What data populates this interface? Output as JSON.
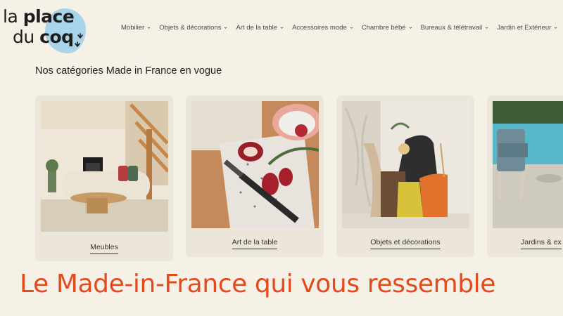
{
  "logo": {
    "line1_light": "la",
    "line1_bold": "place",
    "line2_light": "du",
    "line2_bold": "coq"
  },
  "nav": [
    {
      "label": "Mobilier"
    },
    {
      "label": "Objets & décorations"
    },
    {
      "label": "Art de la table"
    },
    {
      "label": "Accessoires mode"
    },
    {
      "label": "Chambre bébé"
    },
    {
      "label": "Bureaux & télétravail"
    },
    {
      "label": "Jardin et Extérieur"
    }
  ],
  "section_title": "Nos catégories Made in France en vogue",
  "categories": [
    {
      "label": "Meubles"
    },
    {
      "label": "Art de la table"
    },
    {
      "label": "Objets et décorations"
    },
    {
      "label": "Jardins & ex"
    }
  ],
  "headline": "Le Made-in-France qui vous ressemble",
  "colors": {
    "background": "#f5f1e6",
    "card": "#ece6da",
    "accent": "#e34b1f",
    "logo_blob": "#a9d4ea"
  }
}
